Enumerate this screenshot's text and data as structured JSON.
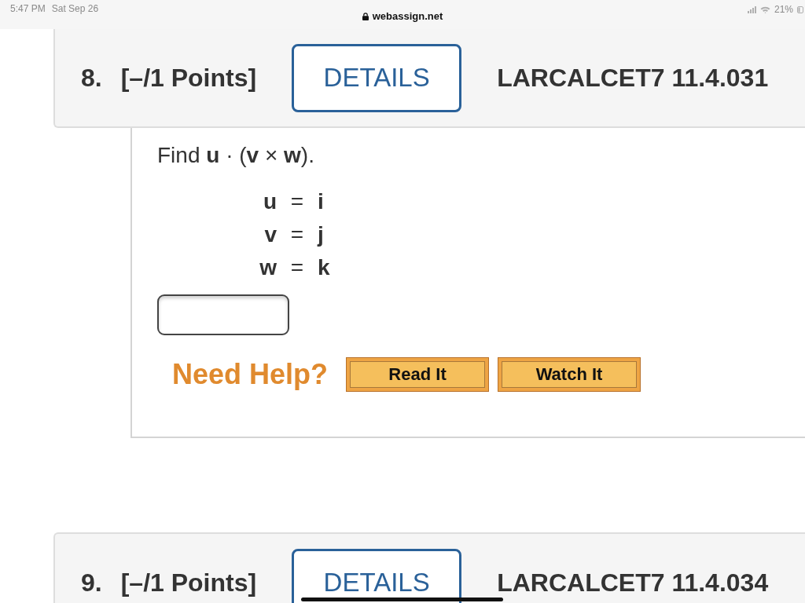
{
  "status_bar": {
    "time": "5:47 PM",
    "date": "Sat Sep 26",
    "battery": "21%"
  },
  "address_bar": {
    "url": "webassign.net"
  },
  "questions": [
    {
      "number": "8.",
      "points": "[–/1 Points]",
      "details_button": "DETAILS",
      "reference": "LARCALCET7 11.4.031",
      "prompt": "Find **u** · (**v** × **w**).",
      "equations": [
        {
          "left": "u",
          "sign": "=",
          "right": "i"
        },
        {
          "left": "v",
          "sign": "=",
          "right": "j"
        },
        {
          "left": "w",
          "sign": "=",
          "right": "k"
        }
      ],
      "help": {
        "label": "Need Help?",
        "buttons": [
          "Read It",
          "Watch It"
        ]
      }
    },
    {
      "number": "9.",
      "points": "[–/1 Points]",
      "details_button": "DETAILS",
      "reference": "LARCALCET7 11.4.034"
    }
  ]
}
